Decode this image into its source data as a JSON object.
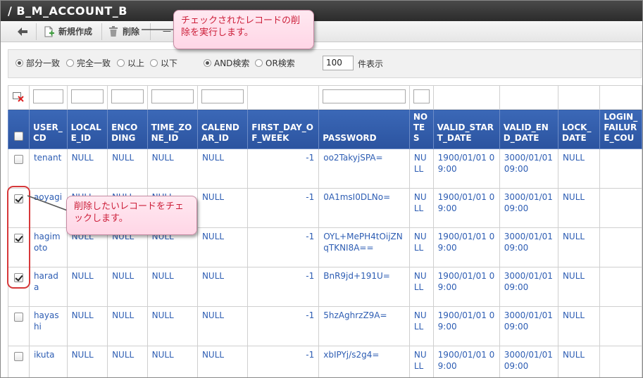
{
  "window": {
    "title": "/ B_M_ACCOUNT_B"
  },
  "toolbar": {
    "back_icon": "arrow-left-icon",
    "new_label": "新規作成",
    "new_icon": "new-document-icon",
    "delete_label": "削除",
    "delete_icon": "trash-icon",
    "more_label": "一"
  },
  "search": {
    "options": [
      {
        "label": "部分一致",
        "selected": true
      },
      {
        "label": "完全一致",
        "selected": false
      },
      {
        "label": "以上",
        "selected": false
      },
      {
        "label": "以下",
        "selected": false
      },
      {
        "label": "AND検索",
        "selected": true
      },
      {
        "label": "OR検索",
        "selected": false
      }
    ],
    "count_value": "100",
    "count_label": "件表示"
  },
  "table": {
    "header_filter_icon": "clear-filter-icon",
    "columns": [
      "USER_CD",
      "LOCALE_ID",
      "ENCODING",
      "TIME_ZONE_ID",
      "CALENDAR_ID",
      "FIRST_DAY_OF_WEEK",
      "PASSWORD",
      "NOTES",
      "VALID_START_DATE",
      "VALID_END_DATE",
      "LOCK_DATE",
      "LOGIN_FAILURE_COU"
    ],
    "rows": [
      {
        "checked": false,
        "cells": [
          "tenant",
          "NULL",
          "NULL",
          "NULL",
          "NULL",
          "-1",
          "oo2TakyjSPA=",
          "NULL",
          "1900/01/01 09:00",
          "3000/01/01 09:00",
          "NULL",
          ""
        ]
      },
      {
        "checked": true,
        "cells": [
          "aoyagi",
          "NULL",
          "NULL",
          "NULL",
          "NULL",
          "-1",
          "0A1msI0DLNo=",
          "NULL",
          "1900/01/01 09:00",
          "3000/01/01 09:00",
          "NULL",
          ""
        ]
      },
      {
        "checked": true,
        "cells": [
          "hagimoto",
          "NULL",
          "NULL",
          "NULL",
          "NULL",
          "-1",
          "OYL+MePH4tOijZNqTKNI8A==",
          "NULL",
          "1900/01/01 09:00",
          "3000/01/01 09:00",
          "NULL",
          ""
        ]
      },
      {
        "checked": true,
        "cells": [
          "harada",
          "NULL",
          "NULL",
          "NULL",
          "NULL",
          "-1",
          "BnR9jd+191U=",
          "NULL",
          "1900/01/01 09:00",
          "3000/01/01 09:00",
          "NULL",
          ""
        ]
      },
      {
        "checked": false,
        "cells": [
          "hayashi",
          "NULL",
          "NULL",
          "NULL",
          "NULL",
          "-1",
          "5hzAghrzZ9A=",
          "NULL",
          "1900/01/01 09:00",
          "3000/01/01 09:00",
          "NULL",
          ""
        ]
      },
      {
        "checked": false,
        "cells": [
          "ikuta",
          "NULL",
          "NULL",
          "NULL",
          "NULL",
          "-1",
          "xbIPYj/s2g4=",
          "NULL",
          "1900/01/01 09:00",
          "3000/01/01 09:00",
          "NULL",
          ""
        ]
      }
    ]
  },
  "annotations": {
    "callout_delete": "チェックされたレコードの削除を実行します。",
    "callout_check": "削除したいレコードをチェックします。",
    "colors": {
      "callout_text": "#cc1f3a",
      "callout_bg": "#ffd6e6",
      "highlight": "#d6383a",
      "header_bg": "#2b539f"
    }
  }
}
